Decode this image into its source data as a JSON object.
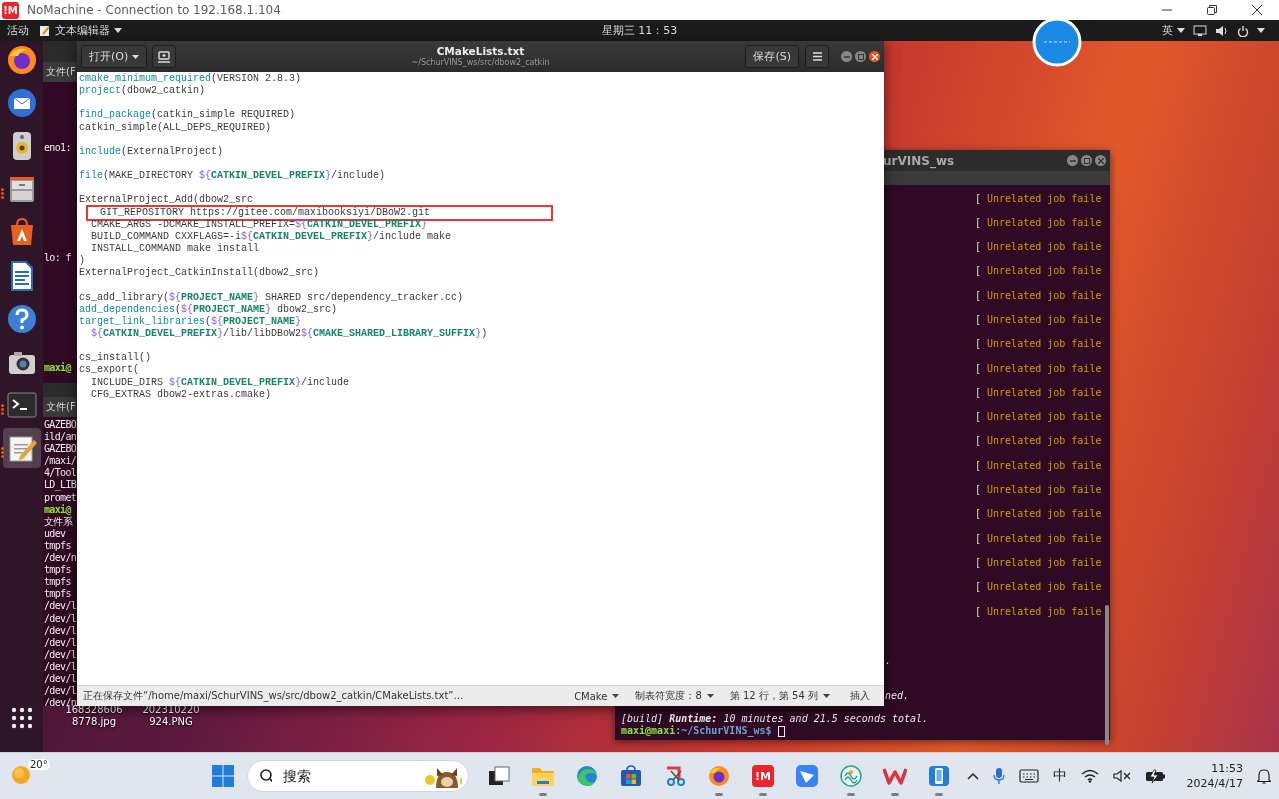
{
  "client_window": {
    "logo_text": "!M",
    "title": "NoMachine - Connection to 192.168.1.104"
  },
  "top_bar": {
    "activities": "活动",
    "app_menu": "文本编辑器",
    "clock": "星期三 11：53",
    "input_method": "英"
  },
  "dock": {
    "items": [
      {
        "kind": "firefox",
        "running": false,
        "selected": false
      },
      {
        "kind": "thunderbird",
        "running": false,
        "selected": false
      },
      {
        "kind": "rhythmbox",
        "running": false,
        "selected": false
      },
      {
        "kind": "files",
        "running": true,
        "selected": false
      },
      {
        "kind": "software",
        "running": false,
        "selected": false
      },
      {
        "kind": "writer",
        "running": false,
        "selected": false
      },
      {
        "kind": "help",
        "running": false,
        "selected": false
      },
      {
        "kind": "screenshot",
        "running": false,
        "selected": false
      },
      {
        "kind": "terminal",
        "running": true,
        "selected": false
      },
      {
        "kind": "text-editor",
        "running": true,
        "selected": true
      }
    ]
  },
  "upper_terminal": {
    "menu": "文件(F",
    "lines": [
      {
        "text": "eno1:",
        "kind": "output"
      },
      {
        "text": "lo: f",
        "kind": "output"
      },
      {
        "text": "maxi@",
        "kind": "prompt"
      }
    ]
  },
  "lower_terminal": {
    "menu": "文件(F",
    "lines": [
      {
        "text": "GAZEBO",
        "kind": "output"
      },
      {
        "text": "ild/an",
        "kind": "output"
      },
      {
        "text": "GAZEBO",
        "kind": "output"
      },
      {
        "text": "/maxi/",
        "kind": "output"
      },
      {
        "text": "4/Tool",
        "kind": "output"
      },
      {
        "text": "LD_LIB",
        "kind": "output"
      },
      {
        "text": "promet",
        "kind": "output"
      },
      {
        "text": "maxi@",
        "kind": "prompt"
      },
      {
        "text": "文件系",
        "kind": "output"
      },
      {
        "text": "udev",
        "kind": "output"
      },
      {
        "text": "tmpfs",
        "kind": "output"
      },
      {
        "text": "/dev/n",
        "kind": "output"
      },
      {
        "text": "tmpfs",
        "kind": "output"
      },
      {
        "text": "tmpfs",
        "kind": "output"
      },
      {
        "text": "tmpfs",
        "kind": "output"
      },
      {
        "text": "/dev/l",
        "kind": "output"
      },
      {
        "text": "/dev/l",
        "kind": "output"
      },
      {
        "text": "/dev/l",
        "kind": "output"
      },
      {
        "text": "/dev/l",
        "kind": "output"
      },
      {
        "text": "/dev/l",
        "kind": "output"
      },
      {
        "text": "/dev/l",
        "kind": "output"
      },
      {
        "text": "/dev/l",
        "kind": "output"
      },
      {
        "text": "/dev/l",
        "kind": "output"
      },
      {
        "text": "/dev/n",
        "kind": "output"
      }
    ]
  },
  "desktop_icons": [
    {
      "label_lines": [
        "168328606",
        "8778.jpg"
      ]
    },
    {
      "label_lines": [
        "202310220",
        "924.PNG"
      ]
    }
  ],
  "build_terminal": {
    "title": "urVINS_ws",
    "job_lines": [
      {
        "bracket": "[",
        "text": "Unrelated job faile"
      },
      {
        "bracket": "[",
        "text": "Unrelated job faile"
      },
      {
        "bracket": "[",
        "text": "Unrelated job faile"
      },
      {
        "bracket": "[",
        "text": "Unrelated job faile"
      },
      {
        "bracket": "[",
        "text": "Unrelated job faile"
      },
      {
        "bracket": "[",
        "text": "Unrelated job faile"
      },
      {
        "bracket": "[",
        "text": "Unrelated job faile"
      },
      {
        "bracket": "[",
        "text": "Unrelated job faile"
      },
      {
        "bracket": "[",
        "text": "Unrelated job faile"
      },
      {
        "bracket": "[",
        "text": "Unrelated job faile"
      },
      {
        "bracket": "[",
        "text": "Unrelated job faile"
      },
      {
        "bracket": "[",
        "text": "Unrelated job faile"
      },
      {
        "bracket": "[",
        "text": "Unrelated job faile"
      },
      {
        "bracket": "[",
        "text": "Unrelated job faile"
      },
      {
        "bracket": "[",
        "text": "Unrelated job faile"
      },
      {
        "bracket": "[",
        "text": "Unrelated job faile"
      },
      {
        "bracket": "[",
        "text": "Unrelated job faile"
      },
      {
        "bracket": "[",
        "text": "Unrelated job faile"
      }
    ],
    "fragments": [
      ".",
      "ned."
    ],
    "summary": "[build] **Runtime:** *10 minutes and 21.5 seconds total.*",
    "prompt_user": "maxi@maxi",
    "prompt_path": ":~/SchurVINS_ws$"
  },
  "editor": {
    "open_button": "打开(O)",
    "title": "CMakeLists.txt",
    "path": "~/SchurVINS_ws/src/dbow2_catkin",
    "save_button": "保存(S)",
    "lines": [
      {
        "boxed": false,
        "space_after": false,
        "tokens": [
          {
            "text": "cmake_minimum_required",
            "kind": "command"
          },
          {
            "text": "(VERSION 2.8.3)",
            "kind": "plain"
          }
        ]
      },
      {
        "boxed": false,
        "space_after": true,
        "tokens": [
          {
            "text": "project",
            "kind": "command"
          },
          {
            "text": "(dbow2_catkin)",
            "kind": "plain"
          }
        ]
      },
      {
        "boxed": false,
        "space_after": false,
        "tokens": [
          {
            "text": "find_package",
            "kind": "command"
          },
          {
            "text": "(catkin_simple REQUIRED)",
            "kind": "plain"
          }
        ]
      },
      {
        "boxed": false,
        "space_after": true,
        "tokens": [
          {
            "text": "catkin_simple(ALL_DEPS_REQUIRED)",
            "kind": "plain"
          }
        ]
      },
      {
        "boxed": false,
        "space_after": true,
        "tokens": [
          {
            "text": "include",
            "kind": "command"
          },
          {
            "text": "(ExternalProject)",
            "kind": "plain"
          }
        ]
      },
      {
        "boxed": false,
        "space_after": true,
        "tokens": [
          {
            "text": "file",
            "kind": "command"
          },
          {
            "text": "(MAKE_DIRECTORY ",
            "kind": "plain"
          },
          {
            "text": "${",
            "kind": "sigil"
          },
          {
            "text": "CATKIN_DEVEL_PREFIX",
            "kind": "variable"
          },
          {
            "text": "}",
            "kind": "sigil"
          },
          {
            "text": "/include)",
            "kind": "plain"
          }
        ]
      },
      {
        "boxed": false,
        "space_after": false,
        "tokens": [
          {
            "text": "ExternalProject_Add(dbow2_src",
            "kind": "plain"
          }
        ]
      },
      {
        "boxed": true,
        "space_after": false,
        "tokens": [
          {
            "text": "  GIT_REPOSITORY https://gitee.com/maxibooksiyi/DBoW2.git",
            "kind": "plain"
          }
        ]
      },
      {
        "boxed": false,
        "space_after": false,
        "tokens": [
          {
            "text": "  CMAKE_ARGS -DCMAKE_INSTALL_PREFIX=",
            "kind": "plain"
          },
          {
            "text": "${",
            "kind": "sigil"
          },
          {
            "text": "CATKIN_DEVEL_PREFIX",
            "kind": "variable"
          },
          {
            "text": "}",
            "kind": "sigil"
          }
        ]
      },
      {
        "boxed": false,
        "space_after": false,
        "tokens": [
          {
            "text": "  BUILD_COMMAND CXXFLAGS=-i",
            "kind": "plain"
          },
          {
            "text": "${",
            "kind": "sigil"
          },
          {
            "text": "CATKIN_DEVEL_PREFIX",
            "kind": "variable"
          },
          {
            "text": "}",
            "kind": "sigil"
          },
          {
            "text": "/include make",
            "kind": "plain"
          }
        ]
      },
      {
        "boxed": false,
        "space_after": false,
        "tokens": [
          {
            "text": "  INSTALL_COMMAND make install",
            "kind": "plain"
          }
        ]
      },
      {
        "boxed": false,
        "space_after": false,
        "tokens": [
          {
            "text": ")",
            "kind": "plain"
          }
        ]
      },
      {
        "boxed": false,
        "space_after": true,
        "tokens": [
          {
            "text": "ExternalProject_CatkinInstall(dbow2_src)",
            "kind": "plain"
          }
        ]
      },
      {
        "boxed": false,
        "space_after": false,
        "tokens": [
          {
            "text": "cs_add_library(",
            "kind": "plain"
          },
          {
            "text": "${",
            "kind": "sigil"
          },
          {
            "text": "PROJECT_NAME",
            "kind": "variable"
          },
          {
            "text": "}",
            "kind": "sigil"
          },
          {
            "text": " SHARED src/dependency_tracker.cc)",
            "kind": "plain"
          }
        ]
      },
      {
        "boxed": false,
        "space_after": false,
        "tokens": [
          {
            "text": "add_dependencies",
            "kind": "command"
          },
          {
            "text": "(",
            "kind": "plain"
          },
          {
            "text": "${",
            "kind": "sigil"
          },
          {
            "text": "PROJECT_NAME",
            "kind": "variable"
          },
          {
            "text": "}",
            "kind": "sigil"
          },
          {
            "text": " dbow2_src)",
            "kind": "plain"
          }
        ]
      },
      {
        "boxed": false,
        "space_after": false,
        "tokens": [
          {
            "text": "target_link_libraries",
            "kind": "command"
          },
          {
            "text": "(",
            "kind": "plain"
          },
          {
            "text": "${",
            "kind": "sigil"
          },
          {
            "text": "PROJECT_NAME",
            "kind": "variable"
          },
          {
            "text": "}",
            "kind": "sigil"
          }
        ]
      },
      {
        "boxed": false,
        "space_after": true,
        "tokens": [
          {
            "text": "  ${",
            "kind": "sigil"
          },
          {
            "text": "CATKIN_DEVEL_PREFIX",
            "kind": "variable"
          },
          {
            "text": "}",
            "kind": "sigil"
          },
          {
            "text": "/lib/libDBoW2",
            "kind": "plain"
          },
          {
            "text": "${",
            "kind": "sigil"
          },
          {
            "text": "CMAKE_SHARED_LIBRARY_SUFFIX",
            "kind": "variable"
          },
          {
            "text": "}",
            "kind": "sigil"
          },
          {
            "text": ")",
            "kind": "plain"
          }
        ]
      },
      {
        "boxed": false,
        "space_after": false,
        "tokens": [
          {
            "text": "cs_install()",
            "kind": "plain"
          }
        ]
      },
      {
        "boxed": false,
        "space_after": false,
        "tokens": [
          {
            "text": "cs_export(",
            "kind": "plain"
          }
        ]
      },
      {
        "boxed": false,
        "space_after": false,
        "tokens": [
          {
            "text": "  INCLUDE_DIRS ",
            "kind": "plain"
          },
          {
            "text": "${",
            "kind": "sigil"
          },
          {
            "text": "CATKIN_DEVEL_PREFIX",
            "kind": "variable"
          },
          {
            "text": "}",
            "kind": "sigil"
          },
          {
            "text": "/include",
            "kind": "plain"
          }
        ]
      },
      {
        "boxed": false,
        "space_after": false,
        "tokens": [
          {
            "text": "  CFG_EXTRAS dbow2-extras.cmake)",
            "kind": "plain"
          }
        ]
      }
    ],
    "status_bar": {
      "message": "正在保存文件“/home/maxi/SchurVINS_ws/src/dbow2_catkin/CMakeLists.txt”…",
      "language": "CMake",
      "tab_width": "制表符宽度：8",
      "position": "第 12 行，第 54 列",
      "mode": "插入"
    }
  },
  "taskbar": {
    "weather": "20°",
    "search_placeholder": "搜索",
    "logo_text": "!M",
    "apps": [
      {
        "kind": "task-view",
        "running": false
      },
      {
        "kind": "file-explorer",
        "running": true
      },
      {
        "kind": "edge",
        "running": false
      },
      {
        "kind": "store",
        "running": false
      },
      {
        "kind": "snipping",
        "running": false
      },
      {
        "kind": "firefox",
        "running": true
      },
      {
        "kind": "nomachine",
        "running": true
      },
      {
        "kind": "feishu",
        "running": false
      },
      {
        "kind": "swirl",
        "running": true
      },
      {
        "kind": "wps",
        "running": true
      },
      {
        "kind": "phone",
        "running": true
      }
    ],
    "ime": "中",
    "time": "11:53",
    "date": "2024/4/17"
  }
}
